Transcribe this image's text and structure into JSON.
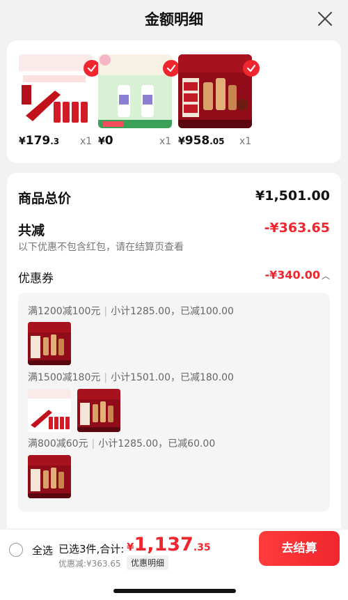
{
  "header": {
    "title": "金额明细",
    "close_icon": "close-icon"
  },
  "products": [
    {
      "name": "cleanser-set",
      "price_cur": "¥",
      "price_int": "179",
      "price_dec": ".3",
      "qty": "x1",
      "selected": true
    },
    {
      "name": "serum-gift",
      "price_cur": "¥",
      "price_int": "0",
      "price_dec": "",
      "qty": "x1",
      "selected": true
    },
    {
      "name": "estee-lauder-set",
      "price_cur": "¥",
      "price_int": "958",
      "price_dec": ".05",
      "qty": "x1",
      "selected": true
    }
  ],
  "summary": {
    "goods_total_label": "商品总价",
    "goods_total_value": "¥1,501.00",
    "total_discount_label": "共减",
    "total_discount_value": "-¥363.65",
    "note": "以下优惠不包含红包，请在结算页查看",
    "coupon_label": "优惠券",
    "coupon_value": "-¥340.00",
    "coupon_icon": "chevron-up-icon"
  },
  "coupon_rules": [
    {
      "rule": "满1200减100元",
      "detail": "小计1285.00，已减100.00"
    },
    {
      "rule": "满1500减180元",
      "detail": "小计1501.00，已减180.00"
    },
    {
      "rule": "满800减60元",
      "detail": "小计1285.00，已减60.00"
    }
  ],
  "bottom": {
    "select_all": "全选",
    "selected_count": "已选3件,合计:",
    "total_cur": "¥",
    "total_int": "1,137",
    "total_dec": ".35",
    "discount_line": "优惠减:¥363.65",
    "detail_link": "优惠明细",
    "checkout": "去结算"
  },
  "colors": {
    "accent": "#f0262e",
    "background": "#f2f2f2",
    "card": "#ffffff",
    "muted": "#777777"
  }
}
